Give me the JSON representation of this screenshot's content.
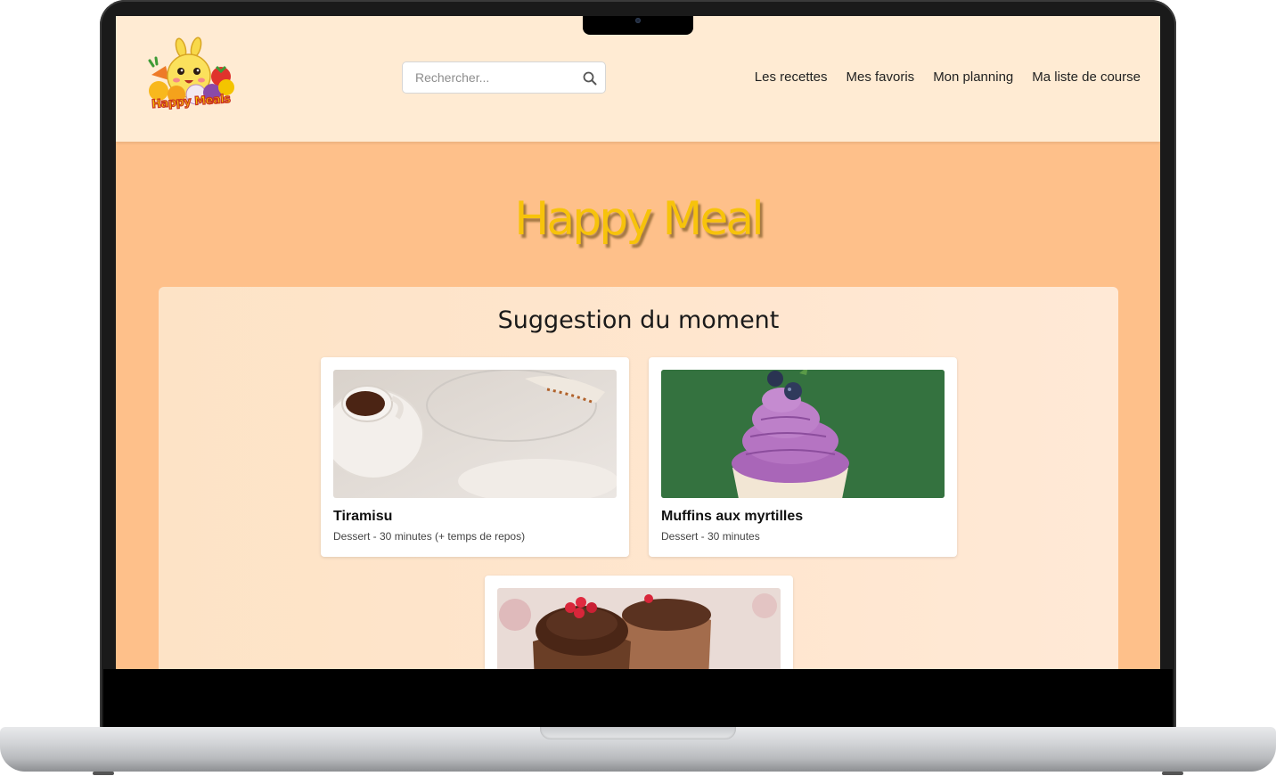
{
  "header": {
    "logo_text": "Happy Meals",
    "search": {
      "placeholder": "Rechercher...",
      "value": ""
    },
    "nav": [
      "Les recettes",
      "Mes favoris",
      "Mon planning",
      "Ma liste de course"
    ]
  },
  "hero": {
    "title": "Happy Meal"
  },
  "suggestions": {
    "title": "Suggestion du moment",
    "cards": [
      {
        "title": "Tiramisu",
        "meta": "Dessert - 30 minutes (+ temps de repos)"
      },
      {
        "title": "Muffins aux myrtilles",
        "meta": "Dessert - 30 minutes"
      },
      {
        "title": "",
        "meta": ""
      }
    ]
  },
  "colors": {
    "header_bg": "#ffebd3",
    "page_bg": "#fec08a",
    "panel_bg": "#ffe6cf",
    "hero_title": "#f7c30b"
  }
}
